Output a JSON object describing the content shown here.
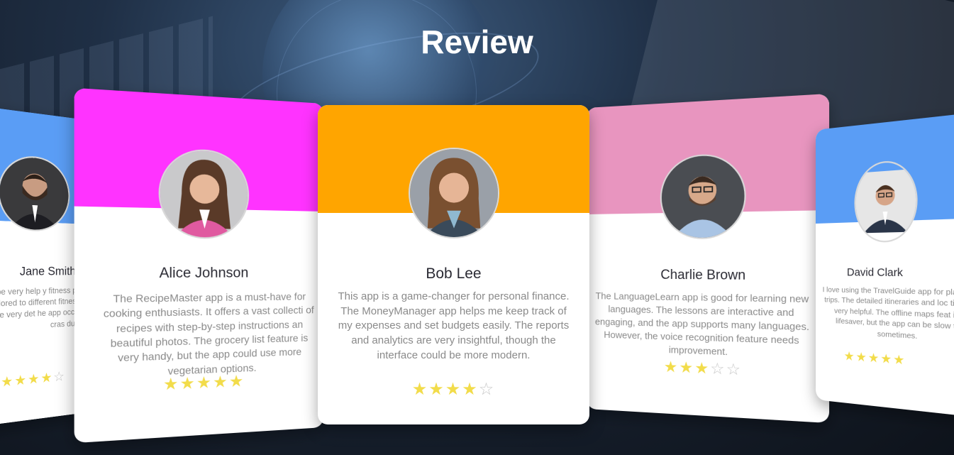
{
  "section": {
    "title": "Review"
  },
  "colors": {
    "orange": "#ffa500",
    "magenta": "#ff33ff",
    "pink": "#e895bf",
    "blue": "#5a9df5",
    "star": "#f2dc4a"
  },
  "reviews": [
    {
      "name": "Jane Smith",
      "text": "tTrack app to be very help y fitness progress. The wor ilored to different fitness le king features are very det he app occasionally cras during use.",
      "stars_filled": "★★★★",
      "stars_empty": "☆",
      "rating": 4,
      "accent": "#5a9df5"
    },
    {
      "name": "Alice Johnson",
      "text": "The RecipeMaster app is a must-have for cooking enthusiasts. It offers a vast collecti of recipes with step-by-step instructions an beautiful photos. The grocery list feature is very handy, but the app could use more vegetarian options.",
      "stars_filled": "★★★★★",
      "stars_empty": "",
      "rating": 5,
      "accent": "#ff33ff"
    },
    {
      "name": "Bob Lee",
      "text": "This app is a game-changer for personal finance. The MoneyManager app helps me keep track of my expenses and set budgets easily. The reports and analytics are very insightful, though the interface could be more modern.",
      "stars_filled": "★★★★",
      "stars_empty": "☆",
      "rating": 4,
      "accent": "#ffa500"
    },
    {
      "name": "Charlie Brown",
      "text": "The LanguageLearn app is good for learning new languages. The lessons are interactive and engaging, and the app supports many languages. However, the voice recognition feature needs improvement.",
      "stars_filled": "★★★",
      "stars_empty": "☆☆",
      "rating": 3,
      "accent": "#e895bf"
    },
    {
      "name": "David Clark",
      "text": "I love using the TravelGuide app for plann my trips. The detailed itineraries and loc tips are very helpful. The offline maps feat is a lifesaver, but the app can be slow to l sometimes.",
      "stars_filled": "★★★★★",
      "stars_empty": "",
      "rating": 5,
      "accent": "#5a9df5"
    }
  ]
}
